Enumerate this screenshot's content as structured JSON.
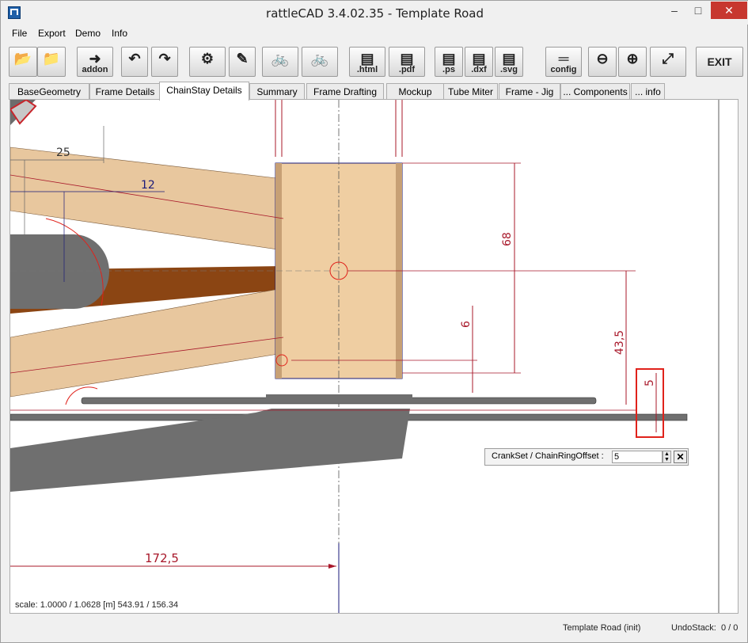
{
  "app": {
    "title": "rattleCAD  3.4.02.35 - Template Road"
  },
  "window_controls": {
    "minimize": "–",
    "maximize": "□",
    "close": "✕"
  },
  "menu": [
    "File",
    "Export",
    "Demo",
    "Info"
  ],
  "toolbar": {
    "buttons": [
      {
        "name": "open-file-button",
        "icon": "folder-icon",
        "glyph": "📂",
        "label": ""
      },
      {
        "name": "open-template-button",
        "icon": "template-icon",
        "glyph": "📁",
        "label": ""
      },
      {
        "name": "addon-button",
        "icon": "addon-arrow-icon",
        "glyph": "➜",
        "label": "addon"
      },
      {
        "name": "undo-button",
        "icon": "undo-icon",
        "glyph": "↶",
        "label": ""
      },
      {
        "name": "redo-button",
        "icon": "redo-icon",
        "glyph": "↷",
        "label": ""
      },
      {
        "name": "render-crankset-button",
        "icon": "crankset-icon",
        "glyph": "⚙",
        "label": ""
      },
      {
        "name": "edit-pencil-button",
        "icon": "pencil-icon",
        "glyph": "✎",
        "label": ""
      },
      {
        "name": "bike-view-button",
        "icon": "bike-red-icon",
        "glyph": "🚲",
        "label": ""
      },
      {
        "name": "bike-view-alt-button",
        "icon": "bike-red-alt-icon",
        "glyph": "🚲",
        "label": ""
      },
      {
        "name": "export-html-button",
        "icon": "html-icon",
        "glyph": "▤",
        "label": ".html"
      },
      {
        "name": "export-pdf-button",
        "icon": "pdf-icon",
        "glyph": "▤",
        "label": ".pdf"
      },
      {
        "name": "export-ps-button",
        "icon": "ps-icon",
        "glyph": "▤",
        "label": ".ps"
      },
      {
        "name": "export-dxf-button",
        "icon": "dxf-icon",
        "glyph": "▤",
        "label": ".dxf"
      },
      {
        "name": "export-svg-button",
        "icon": "svg-icon",
        "glyph": "▤",
        "label": ".svg"
      },
      {
        "name": "config-button",
        "icon": "config-slider-icon",
        "glyph": "═",
        "label": "config"
      },
      {
        "name": "zoom-out-button",
        "icon": "zoom-out-icon",
        "glyph": "⊖",
        "label": ""
      },
      {
        "name": "zoom-in-button",
        "icon": "zoom-in-icon",
        "glyph": "⊕",
        "label": ""
      },
      {
        "name": "zoom-fit-button",
        "icon": "zoom-fit-icon",
        "glyph": "⤢",
        "label": ""
      },
      {
        "name": "exit-button",
        "icon": "",
        "glyph": "",
        "label": "EXIT"
      }
    ]
  },
  "tabs": [
    {
      "label": "BaseGeometry",
      "active": false
    },
    {
      "label": "Frame Details",
      "active": false
    },
    {
      "label": "ChainStay Details",
      "active": true
    },
    {
      "label": "Summary",
      "active": false
    },
    {
      "label": "Frame Drafting",
      "active": false
    },
    {
      "label": "Mockup",
      "active": false
    },
    {
      "label": "Tube Miter",
      "active": false
    },
    {
      "label": "Frame - Jig",
      "active": false
    },
    {
      "label": "... Components",
      "active": false
    },
    {
      "label": "... info",
      "active": false
    }
  ],
  "drawing": {
    "dimensions": [
      "25",
      "12",
      "68",
      "6",
      "43,5",
      "5",
      "172,5"
    ],
    "highlight_color": "#e0221b",
    "tube_color": "#e8c79e",
    "dark_tube_color": "#8b4513",
    "cassette_color": "#6f6f6f",
    "dimension_color": "#a8182a",
    "centerline_color": "#1a1a7a"
  },
  "param_dialog": {
    "label": "CrankSet / ChainRingOffset  :",
    "value": "5",
    "close": "✕"
  },
  "scale_text": "scale: 1.0000 / 1.0628  [m]  543.91 / 156.34",
  "status": {
    "template": "Template Road (init)",
    "undo_label": "UndoStack:",
    "undo_value": "0 / 0"
  }
}
